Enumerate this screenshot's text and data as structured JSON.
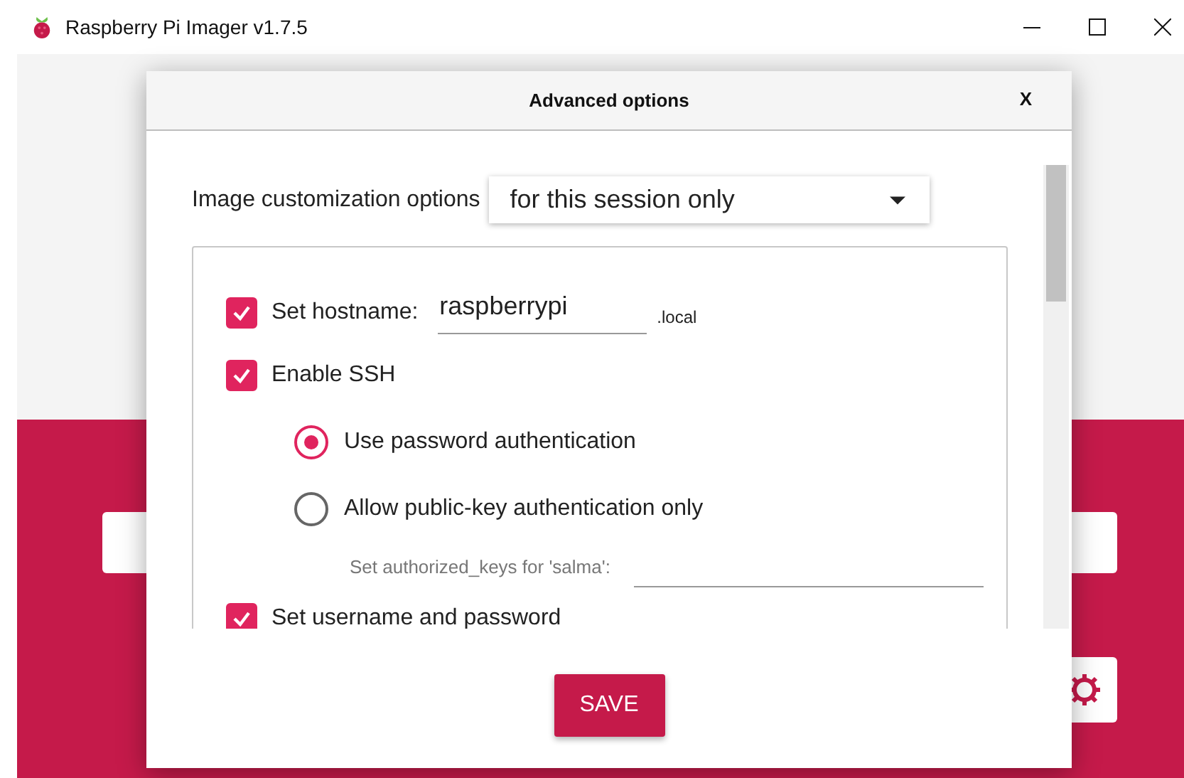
{
  "window": {
    "title": "Raspberry Pi Imager v1.7.5"
  },
  "dialog": {
    "title": "Advanced options",
    "close": "X",
    "customization": {
      "label": "Image customization options",
      "value": "for this session only"
    },
    "hostname": {
      "label": "Set hostname:",
      "checked": true,
      "value": "raspberrypi",
      "suffix": ".local"
    },
    "ssh": {
      "label": "Enable SSH",
      "checked": true,
      "auth": [
        {
          "label": "Use password authentication",
          "selected": true
        },
        {
          "label": "Allow public-key authentication only",
          "selected": false
        }
      ],
      "keys_label": "Set authorized_keys for 'salma':"
    },
    "user": {
      "label": "Set username and password",
      "checked": true
    },
    "save": "SAVE"
  }
}
